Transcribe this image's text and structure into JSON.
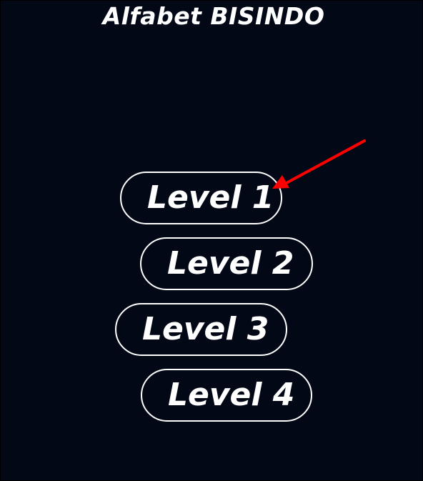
{
  "app": {
    "title": "Alfabet BISINDO"
  },
  "levels": [
    {
      "label": "Level 1"
    },
    {
      "label": "Level 2"
    },
    {
      "label": "Level 3"
    },
    {
      "label": "Level 4"
    }
  ],
  "annotation": {
    "icon": "red-arrow-icon",
    "color": "#ff0000",
    "points_to": "Level 1"
  },
  "colors": {
    "background": "#030817",
    "text": "#ffffff",
    "button_border": "#ffffff"
  }
}
